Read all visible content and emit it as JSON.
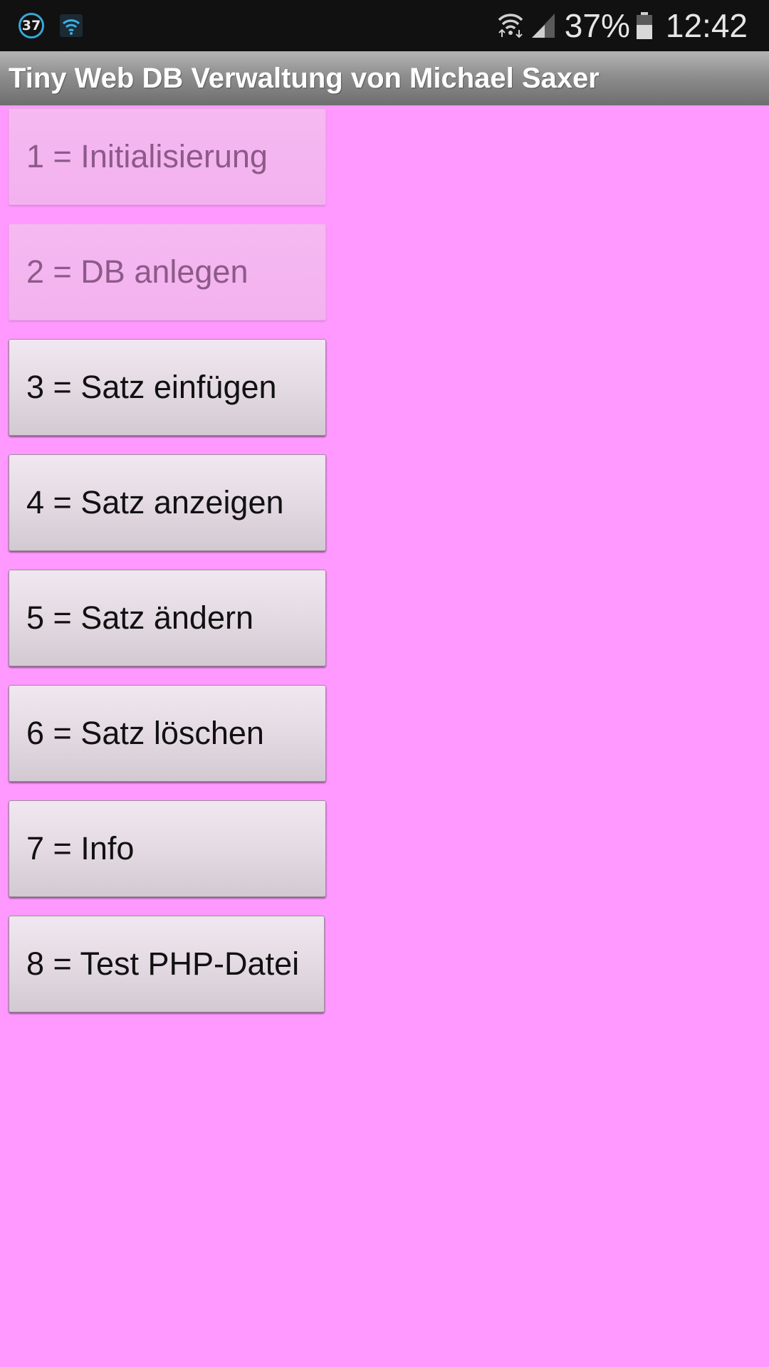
{
  "status_bar": {
    "notification_badge": "37",
    "battery_percent": "37%",
    "time": "12:42",
    "icons": [
      "notification-badge-icon",
      "wifi-notification-icon",
      "wifi-icon",
      "signal-icon",
      "battery-icon"
    ]
  },
  "app": {
    "title": "Tiny Web DB Verwaltung von Michael Saxer",
    "background_color": "#ff99ff"
  },
  "buttons": [
    {
      "label": "1 = Initialisierung",
      "enabled": false
    },
    {
      "label": "2 = DB anlegen",
      "enabled": false
    },
    {
      "label": "3 = Satz einfügen",
      "enabled": true
    },
    {
      "label": "4 = Satz anzeigen",
      "enabled": true
    },
    {
      "label": "5 = Satz ändern",
      "enabled": true
    },
    {
      "label": "6 = Satz löschen",
      "enabled": true
    },
    {
      "label": "7 = Info",
      "enabled": true
    },
    {
      "label": "8 = Test PHP-Datei",
      "enabled": true
    }
  ]
}
